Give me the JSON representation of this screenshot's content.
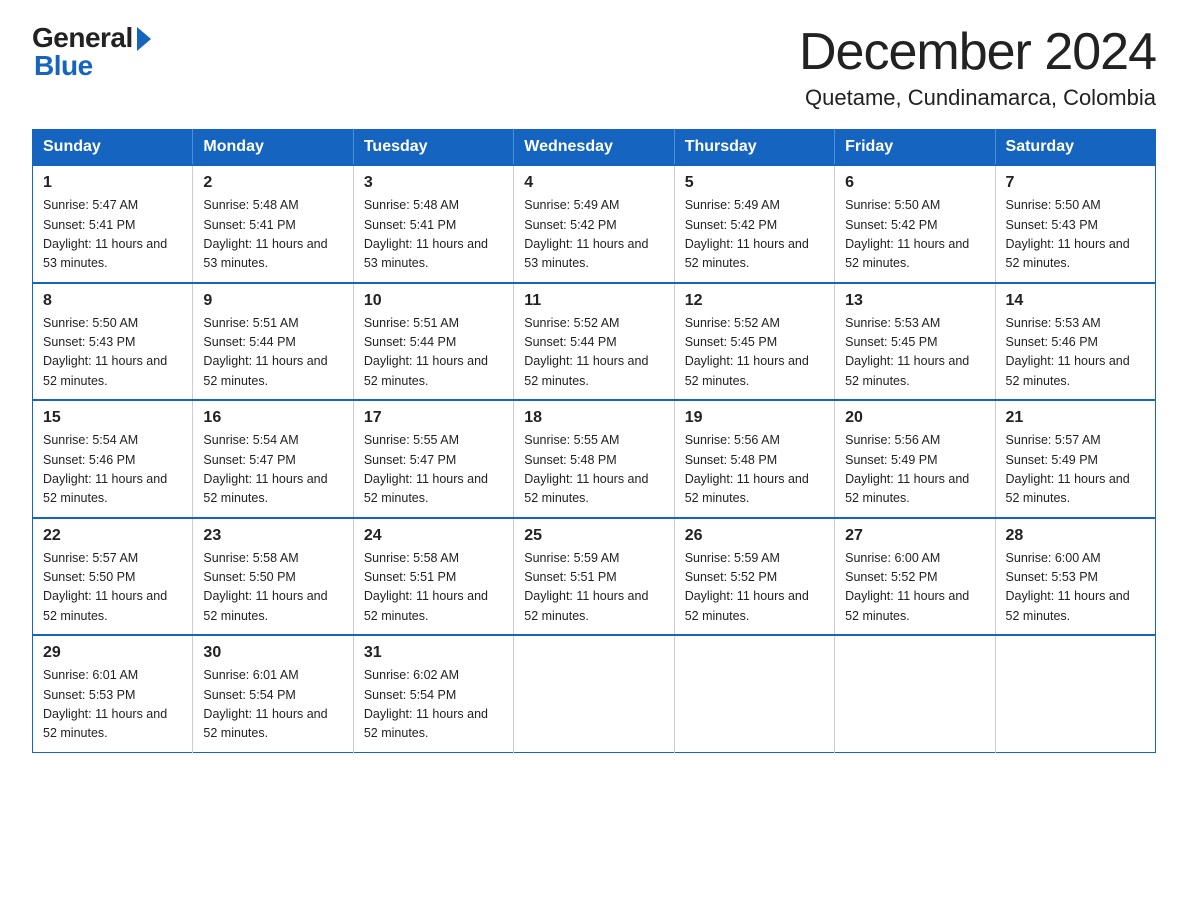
{
  "logo": {
    "general": "General",
    "blue": "Blue"
  },
  "title": "December 2024",
  "subtitle": "Quetame, Cundinamarca, Colombia",
  "days_of_week": [
    "Sunday",
    "Monday",
    "Tuesday",
    "Wednesday",
    "Thursday",
    "Friday",
    "Saturday"
  ],
  "weeks": [
    [
      {
        "day": "1",
        "sunrise": "5:47 AM",
        "sunset": "5:41 PM",
        "daylight": "11 hours and 53 minutes."
      },
      {
        "day": "2",
        "sunrise": "5:48 AM",
        "sunset": "5:41 PM",
        "daylight": "11 hours and 53 minutes."
      },
      {
        "day": "3",
        "sunrise": "5:48 AM",
        "sunset": "5:41 PM",
        "daylight": "11 hours and 53 minutes."
      },
      {
        "day": "4",
        "sunrise": "5:49 AM",
        "sunset": "5:42 PM",
        "daylight": "11 hours and 53 minutes."
      },
      {
        "day": "5",
        "sunrise": "5:49 AM",
        "sunset": "5:42 PM",
        "daylight": "11 hours and 52 minutes."
      },
      {
        "day": "6",
        "sunrise": "5:50 AM",
        "sunset": "5:42 PM",
        "daylight": "11 hours and 52 minutes."
      },
      {
        "day": "7",
        "sunrise": "5:50 AM",
        "sunset": "5:43 PM",
        "daylight": "11 hours and 52 minutes."
      }
    ],
    [
      {
        "day": "8",
        "sunrise": "5:50 AM",
        "sunset": "5:43 PM",
        "daylight": "11 hours and 52 minutes."
      },
      {
        "day": "9",
        "sunrise": "5:51 AM",
        "sunset": "5:44 PM",
        "daylight": "11 hours and 52 minutes."
      },
      {
        "day": "10",
        "sunrise": "5:51 AM",
        "sunset": "5:44 PM",
        "daylight": "11 hours and 52 minutes."
      },
      {
        "day": "11",
        "sunrise": "5:52 AM",
        "sunset": "5:44 PM",
        "daylight": "11 hours and 52 minutes."
      },
      {
        "day": "12",
        "sunrise": "5:52 AM",
        "sunset": "5:45 PM",
        "daylight": "11 hours and 52 minutes."
      },
      {
        "day": "13",
        "sunrise": "5:53 AM",
        "sunset": "5:45 PM",
        "daylight": "11 hours and 52 minutes."
      },
      {
        "day": "14",
        "sunrise": "5:53 AM",
        "sunset": "5:46 PM",
        "daylight": "11 hours and 52 minutes."
      }
    ],
    [
      {
        "day": "15",
        "sunrise": "5:54 AM",
        "sunset": "5:46 PM",
        "daylight": "11 hours and 52 minutes."
      },
      {
        "day": "16",
        "sunrise": "5:54 AM",
        "sunset": "5:47 PM",
        "daylight": "11 hours and 52 minutes."
      },
      {
        "day": "17",
        "sunrise": "5:55 AM",
        "sunset": "5:47 PM",
        "daylight": "11 hours and 52 minutes."
      },
      {
        "day": "18",
        "sunrise": "5:55 AM",
        "sunset": "5:48 PM",
        "daylight": "11 hours and 52 minutes."
      },
      {
        "day": "19",
        "sunrise": "5:56 AM",
        "sunset": "5:48 PM",
        "daylight": "11 hours and 52 minutes."
      },
      {
        "day": "20",
        "sunrise": "5:56 AM",
        "sunset": "5:49 PM",
        "daylight": "11 hours and 52 minutes."
      },
      {
        "day": "21",
        "sunrise": "5:57 AM",
        "sunset": "5:49 PM",
        "daylight": "11 hours and 52 minutes."
      }
    ],
    [
      {
        "day": "22",
        "sunrise": "5:57 AM",
        "sunset": "5:50 PM",
        "daylight": "11 hours and 52 minutes."
      },
      {
        "day": "23",
        "sunrise": "5:58 AM",
        "sunset": "5:50 PM",
        "daylight": "11 hours and 52 minutes."
      },
      {
        "day": "24",
        "sunrise": "5:58 AM",
        "sunset": "5:51 PM",
        "daylight": "11 hours and 52 minutes."
      },
      {
        "day": "25",
        "sunrise": "5:59 AM",
        "sunset": "5:51 PM",
        "daylight": "11 hours and 52 minutes."
      },
      {
        "day": "26",
        "sunrise": "5:59 AM",
        "sunset": "5:52 PM",
        "daylight": "11 hours and 52 minutes."
      },
      {
        "day": "27",
        "sunrise": "6:00 AM",
        "sunset": "5:52 PM",
        "daylight": "11 hours and 52 minutes."
      },
      {
        "day": "28",
        "sunrise": "6:00 AM",
        "sunset": "5:53 PM",
        "daylight": "11 hours and 52 minutes."
      }
    ],
    [
      {
        "day": "29",
        "sunrise": "6:01 AM",
        "sunset": "5:53 PM",
        "daylight": "11 hours and 52 minutes."
      },
      {
        "day": "30",
        "sunrise": "6:01 AM",
        "sunset": "5:54 PM",
        "daylight": "11 hours and 52 minutes."
      },
      {
        "day": "31",
        "sunrise": "6:02 AM",
        "sunset": "5:54 PM",
        "daylight": "11 hours and 52 minutes."
      },
      null,
      null,
      null,
      null
    ]
  ]
}
